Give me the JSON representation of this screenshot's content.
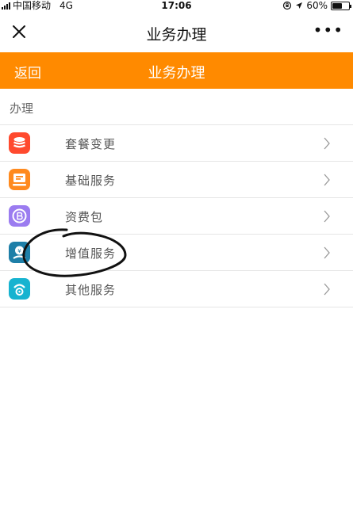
{
  "status_bar": {
    "carrier": "中国移动",
    "network": "4G",
    "time": "17:06",
    "battery": "60%",
    "battery_level": 0.6
  },
  "nav": {
    "close_icon": "close-icon",
    "title": "业务办理",
    "more": "•••"
  },
  "header": {
    "back_label": "返回",
    "title": "业务办理",
    "color": "#ff8a00"
  },
  "section": {
    "label": "办理"
  },
  "items": [
    {
      "label": "套餐变更",
      "icon": "package-stack-icon",
      "color": "#ff4a2e"
    },
    {
      "label": "基础服务",
      "icon": "basic-service-icon",
      "color": "#ff8a1e"
    },
    {
      "label": "资费包",
      "icon": "fee-coin-icon",
      "color": "#9b7cf0"
    },
    {
      "label": "增值服务",
      "icon": "value-added-icon",
      "color": "#1e7fa8"
    },
    {
      "label": "其他服务",
      "icon": "other-service-icon",
      "color": "#17b3d0"
    }
  ]
}
